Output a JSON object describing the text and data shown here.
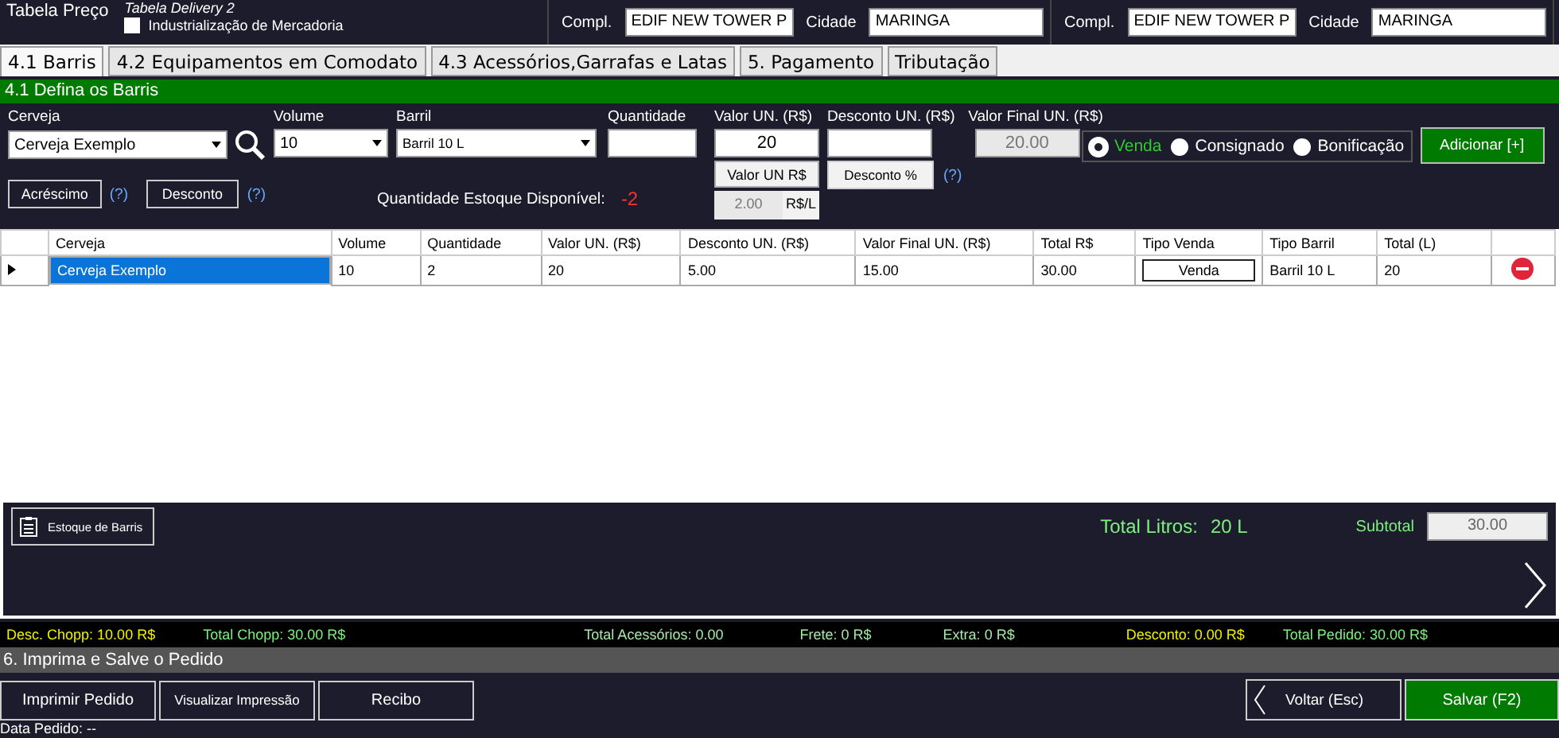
{
  "header": {
    "price_table_label": "Tabela Preço",
    "price_table_value": "Tabela Delivery 2",
    "industrialization": {
      "label": "Industrialização de Mercadoria",
      "checked": false
    },
    "addresses": [
      {
        "compl_label": "Compl.",
        "compl_value": "EDIF NEW TOWER P",
        "city_label": "Cidade",
        "city_value": "MARINGA"
      },
      {
        "compl_label": "Compl.",
        "compl_value": "EDIF NEW TOWER P",
        "city_label": "Cidade",
        "city_value": "MARINGA"
      }
    ]
  },
  "tabs": [
    {
      "label": "4.1 Barris",
      "selected": true
    },
    {
      "label": "4.2 Equipamentos em Comodato",
      "selected": false
    },
    {
      "label": "4.3 Acessórios,Garrafas e Latas",
      "selected": false
    },
    {
      "label": "5. Pagamento",
      "selected": false
    },
    {
      "label": "Tributação",
      "selected": false
    }
  ],
  "section_title": "4.1 Defina os Barris",
  "form": {
    "beer": {
      "label": "Cerveja",
      "value": "Cerveja Exemplo"
    },
    "volume": {
      "label": "Volume",
      "value": "10"
    },
    "keg": {
      "label": "Barril",
      "value": "Barril 10 L"
    },
    "quantity": {
      "label": "Quantidade"
    },
    "unit_value": {
      "label": "Valor UN. (R$)",
      "value": "20",
      "button": "Valor UN R$",
      "per_liter": "2.00",
      "per_liter_unit": "R$/L"
    },
    "discount": {
      "label": "Desconto UN. (R$)",
      "button": "Desconto %",
      "help": "(?)"
    },
    "final_value": {
      "label": "Valor Final UN. (R$)",
      "value": "20.00"
    },
    "sale_types": [
      {
        "label": "Venda",
        "selected": true
      },
      {
        "label": "Consignado",
        "selected": false
      },
      {
        "label": "Bonificação",
        "selected": false
      }
    ],
    "add_button": "Adicionar [+]",
    "surcharge_button": "Acréscimo",
    "surcharge_help": "(?)",
    "discount_button": "Desconto",
    "discount_help": "(?)",
    "stock_label": "Quantidade Estoque Disponível:",
    "stock_value": "-2"
  },
  "table": {
    "columns": [
      "Cerveja",
      "Volume",
      "Quantidade",
      "Valor UN. (R$)",
      "Desconto UN. (R$)",
      "Valor Final UN. (R$)",
      "Total R$",
      "Tipo Venda",
      "Tipo Barril",
      "Total (L)"
    ],
    "rows": [
      {
        "cells": [
          "Cerveja Exemplo",
          "10",
          "2",
          "20",
          "5.00",
          "15.00",
          "30.00",
          "Venda",
          "Barril 10 L",
          "20"
        ],
        "selected": true
      }
    ]
  },
  "lower": {
    "stock_button": "Estoque de Barris",
    "total_liters_label": "Total Litros:",
    "total_liters_value": "20 L",
    "subtotal_label": "Subtotal",
    "subtotal_value": "30.00"
  },
  "summary": [
    {
      "label": "Desc. Chopp:",
      "value": "10.00 R$",
      "color": "#f2f200"
    },
    {
      "label": "Total Chopp:",
      "value": "30.00 R$",
      "color": "#7ff07f"
    },
    {
      "label": "Total Acessórios:",
      "value": "0.00",
      "color": "#a8e8a8"
    },
    {
      "label": "Frete:",
      "value": "0 R$",
      "color": "#a8e8a8"
    },
    {
      "label": "Extra:",
      "value": "0 R$",
      "color": "#a8e8a8"
    },
    {
      "label": "Desconto:",
      "value": "0.00 R$",
      "color": "#f2f200"
    },
    {
      "label": "Total Pedido:",
      "value": "30.00 R$",
      "color": "#7ff07f"
    }
  ],
  "save_section": {
    "title": "6. Imprima e Salve o Pedido",
    "buttons": [
      "Imprimir Pedido",
      "Visualizar Impressão",
      "Recibo"
    ],
    "back_button": "Voltar (Esc)",
    "save_button": "Salvar (F2)",
    "order_date": "Data Pedido: --"
  }
}
